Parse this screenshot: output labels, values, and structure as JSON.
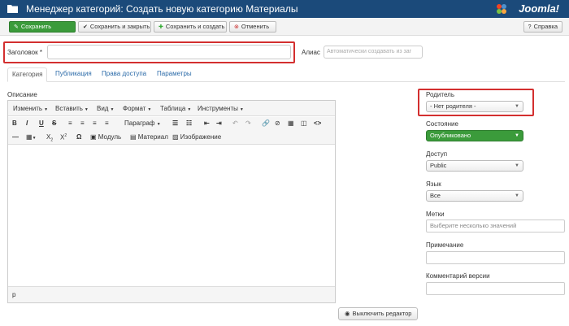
{
  "header": {
    "title": "Менеджер категорий: Создать новую категорию Материалы",
    "logo": "Joomla!"
  },
  "toolbar": {
    "save": "Сохранить",
    "save_close": "Сохранить и закрыть",
    "save_new": "Сохранить и создать",
    "cancel": "Отменить",
    "help": "Справка"
  },
  "form": {
    "title_label": "Заголовок *",
    "title_value": "",
    "alias_label": "Алиас",
    "alias_placeholder": "Автоматически создавать из заг"
  },
  "tabs": [
    {
      "label": "Категория",
      "active": true
    },
    {
      "label": "Публикация"
    },
    {
      "label": "Права доступа"
    },
    {
      "label": "Параметры"
    }
  ],
  "editor": {
    "label": "Описание",
    "menus": [
      "Изменить",
      "Вставить",
      "Вид",
      "Формат",
      "Таблица",
      "Инструменты"
    ],
    "paragraph": "Параграф",
    "module": "Модуль",
    "article": "Материал",
    "image": "Изображение",
    "status_path": "p",
    "toggle": "Выключить редактор"
  },
  "sidebar": {
    "parent_label": "Родитель",
    "parent_value": "- Нет родителя -",
    "state_label": "Состояние",
    "state_value": "Опубликовано",
    "access_label": "Доступ",
    "access_value": "Public",
    "language_label": "Язык",
    "language_value": "Все",
    "tags_label": "Метки",
    "tags_placeholder": "Выберите несколько значений",
    "note_label": "Примечание",
    "version_label": "Комментарий версии"
  },
  "colors": {
    "header_bg": "#1b4a7a",
    "accent_green": "#3b9b3b",
    "highlight_red": "#d32f2f",
    "link_blue": "#2a6aa8"
  }
}
